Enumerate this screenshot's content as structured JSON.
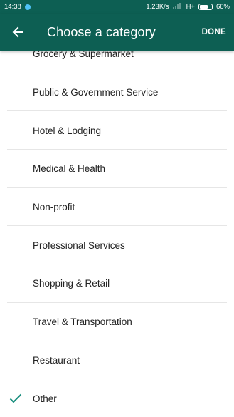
{
  "status_bar": {
    "time": "14:38",
    "speed": "1.23K/s",
    "network": "H+",
    "battery": "66%",
    "battery_level": 0.66
  },
  "app_bar": {
    "title": "Choose a category",
    "done_label": "DONE",
    "back_icon": "arrow-back-icon"
  },
  "categories": [
    {
      "label": "Grocery & Supermarket",
      "selected": false
    },
    {
      "label": "Public & Government Service",
      "selected": false
    },
    {
      "label": "Hotel & Lodging",
      "selected": false
    },
    {
      "label": "Medical & Health",
      "selected": false
    },
    {
      "label": "Non-profit",
      "selected": false
    },
    {
      "label": "Professional Services",
      "selected": false
    },
    {
      "label": "Shopping & Retail",
      "selected": false
    },
    {
      "label": "Travel & Transportation",
      "selected": false
    },
    {
      "label": "Restaurant",
      "selected": false
    },
    {
      "label": "Other",
      "selected": true
    }
  ],
  "colors": {
    "primary": "#0d5f53",
    "check": "#1b8f7f"
  }
}
